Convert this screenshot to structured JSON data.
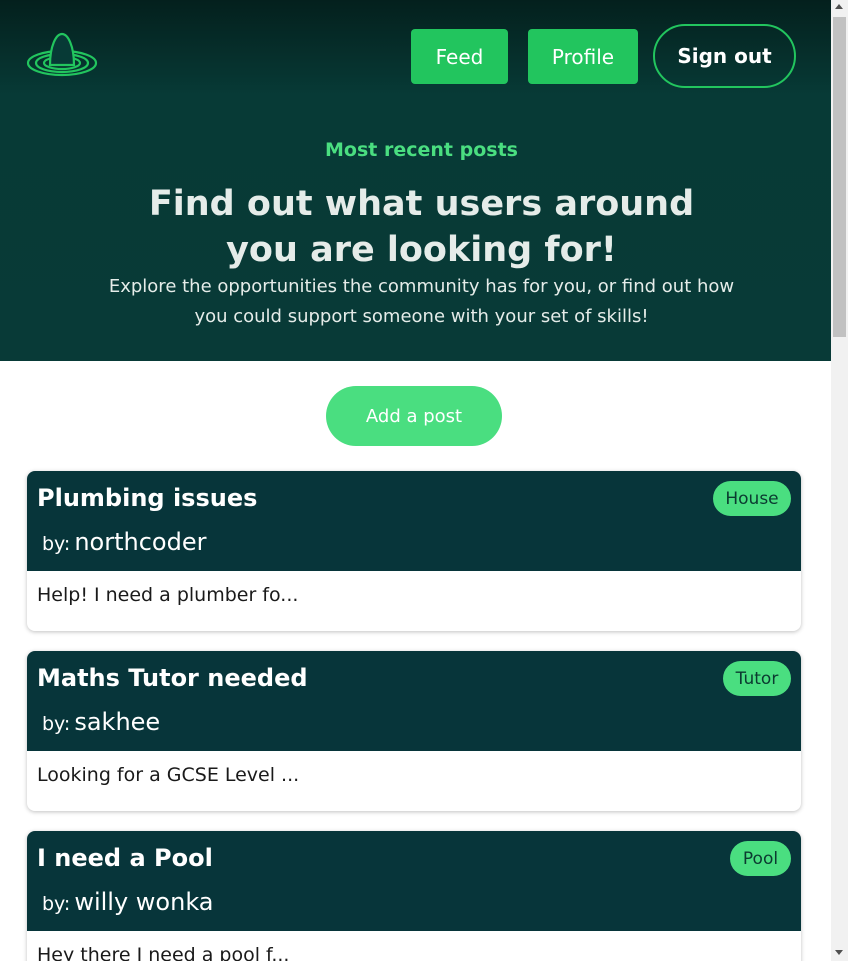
{
  "nav": {
    "feed_label": "Feed",
    "profile_label": "Profile",
    "signout_label": "Sign out"
  },
  "hero": {
    "eyebrow": "Most recent posts",
    "headline": "Find out what users around you are looking for!",
    "subline": "Explore the opportunities the community has for you, or find out how you could support someone with your set of skills!"
  },
  "actions": {
    "add_post_label": "Add a post"
  },
  "posts": [
    {
      "title": "Plumbing issues",
      "by_label": "by:",
      "author": "northcoder",
      "tag": "House",
      "excerpt": "Help! I need a plumber fo..."
    },
    {
      "title": "Maths Tutor needed",
      "by_label": "by:",
      "author": "sakhee",
      "tag": "Tutor",
      "excerpt": "Looking for a GCSE Level ..."
    },
    {
      "title": "I need a Pool",
      "by_label": "by:",
      "author": "willy wonka",
      "tag": "Pool",
      "excerpt": "Hey there I need a pool f..."
    }
  ],
  "colors": {
    "accent": "#22c55e",
    "accent_light": "#4ade80",
    "hero_bg": "#083a37",
    "card_header_bg": "#07353a"
  },
  "icons": {
    "logo": "green-orbit-egg-logo"
  }
}
